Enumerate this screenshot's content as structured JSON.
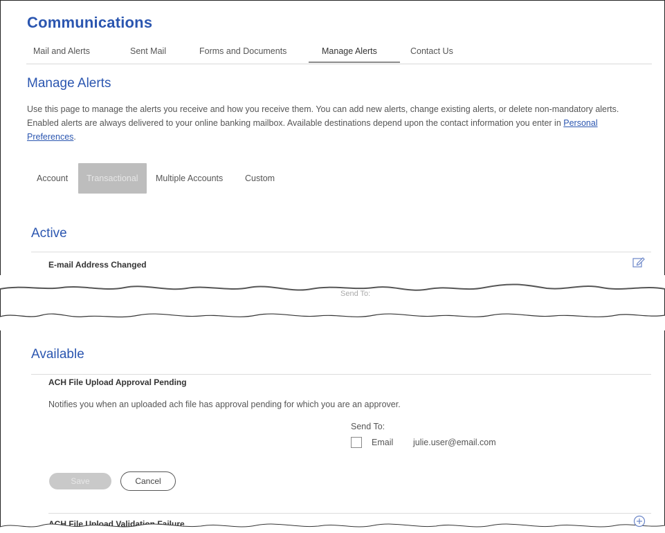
{
  "page": {
    "title": "Communications"
  },
  "tabs": [
    {
      "label": "Mail and Alerts"
    },
    {
      "label": "Sent Mail"
    },
    {
      "label": "Forms and Documents"
    },
    {
      "label": "Manage Alerts"
    },
    {
      "label": "Contact Us"
    }
  ],
  "manage": {
    "heading": "Manage Alerts",
    "description_before_link": "Use this page to manage the alerts you receive and how you receive them. You can add new alerts, change existing alerts, or delete non-mandatory alerts. Enabled alerts are always delivered to your online banking mailbox. Available destinations depend upon the contact information you enter in ",
    "link": "Personal Preferences",
    "description_after_link": "."
  },
  "subtabs": [
    {
      "label": "Account"
    },
    {
      "label": "Transactional"
    },
    {
      "label": "Multiple Accounts"
    },
    {
      "label": "Custom"
    }
  ],
  "active": {
    "heading": "Active",
    "alert_title": "E-mail Address Changed",
    "send_to_label": "Send To:"
  },
  "available": {
    "heading": "Available",
    "alert1": {
      "title": "ACH File Upload Approval Pending",
      "description": "Notifies you when an uploaded ach file has approval pending for which you are an approver.",
      "send_to_label": "Send To:",
      "email_label": "Email",
      "email_value": "julie.user@email.com",
      "email_checked": false,
      "save_label": "Save",
      "cancel_label": "Cancel"
    },
    "alert2": {
      "title": "ACH File Upload Validation Failure"
    }
  },
  "icons": {
    "edit": "edit-icon",
    "add": "plus-circle-icon"
  },
  "colors": {
    "accent": "#2b56b0",
    "selected_tab": "#bdbdbd",
    "disabled_button": "#c9c9c9"
  }
}
